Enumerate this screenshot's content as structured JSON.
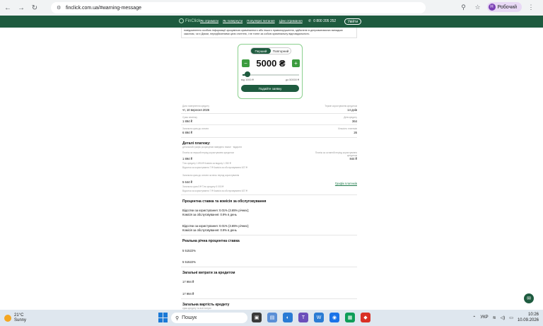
{
  "browser": {
    "url": "finclick.com.ua/#warning-message",
    "profile_label": "Робочий",
    "profile_initial": "Н"
  },
  "site": {
    "logo_text": "FinClick",
    "nav": [
      "Як отримати",
      "Як повернути",
      "Популярні питання",
      "Ціни отримання"
    ],
    "phone": "0 800 205 252",
    "login_label": "Увійти"
  },
  "warning": {
    "text": "повідомлення особою інформації зрозумілою криміналного або іншого правопорушення, здійснене в депривативаних випадках законом, чи є Діями, передбаченими цією статтею, і не тягне за собою кримінальну відповідальність"
  },
  "calculator": {
    "tab_first": "Перший",
    "tab_repeat": "Повторний",
    "amount": "5000 ₴",
    "minus": "−",
    "plus": "+",
    "range_min": "від 1000 ₴",
    "range_max": "до 50000 ₴",
    "submit_label": "Подайте заявку",
    "slider_fraction": 0.08
  },
  "summary": {
    "return_date_label": "Дата повернення кредиту",
    "return_date": "чт, 10 вересня 2026",
    "term_label": "Термін користування кредитом",
    "term": "14 днів",
    "payment_label": "Сума платежу",
    "payment": "1 894 ₴",
    "days_label": "Днів кредиту",
    "days": "364",
    "total_label": "Загальна сума до сплати",
    "total": "6 894 ₴",
    "count_label": "Кількість платежів",
    "count": "26"
  },
  "details": {
    "title": "Деталі платежу:",
    "subtitle": "детальний графік розрахунків наведено нижче · відкрити",
    "col1_label": "Платіж за перший період користування кредитом",
    "col1_value": "1 894 ₴",
    "col1_note1": "Тіло кредиту 1 894 ₴ Комісія за видачу 1 250 ₴",
    "col1_note2": "Відсотки за користування 7 ₴ Комісія за обслуговування 637 ₴",
    "col2_label": "Платіж за останній період користування кредитом",
    "col2_value": "844 ₴",
    "sum_label": "Загальна сума до сплати за весь період користування",
    "sum_value": "5 644 ₴",
    "sum_note1": "Загальна сума 5 ₴ Тіло кредиту 5 000 ₴",
    "sum_note2": "Відсотки за користування 7 ₴ Комісія за обслуговування 637 ₴",
    "schedule_link": "Графік платежів"
  },
  "rates": {
    "title": "Процентна ставка та комісія за обслуговування",
    "line1a": "Відсотки за користування: 0.01% (3.65% річних);",
    "line1b": "Комісія за обслуговування: 0.9% в день",
    "line2a": "Відсотки за користування: 0.01% (3.65% річних);",
    "line2b": "Комісія за обслуговування: 0.9% в день"
  },
  "apr": {
    "title": "Реальна річна процентна ставка",
    "value1": "5 51522%",
    "value2": "5 51522%"
  },
  "costs": {
    "title": "Загальні витрати за кредитом",
    "value1": "17 994 ₴",
    "value2": "17 994 ₴"
  },
  "total_cost": {
    "title": "Загальна вартість кредиту",
    "note": "сума кредиту та всіх витрат"
  },
  "taskbar": {
    "temp": "21°C",
    "weather": "Sunny",
    "search": "Пошук",
    "lang": "УКР",
    "time": "10:26",
    "date": "10.09.2026"
  },
  "colors": {
    "brand": "#1e5b3f",
    "accent": "#3c9c3f"
  }
}
